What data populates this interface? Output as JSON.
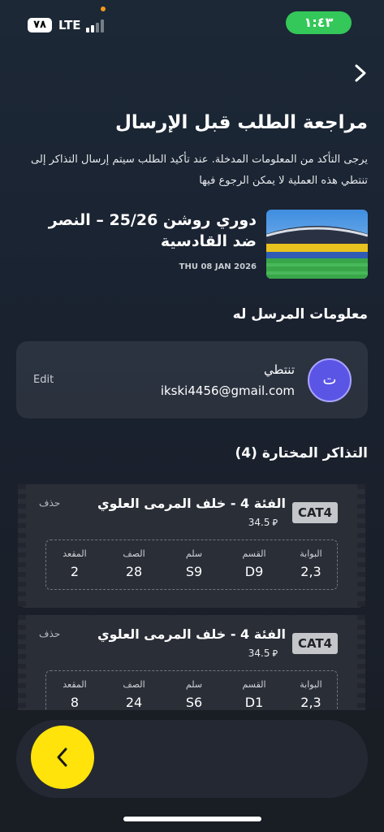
{
  "status_bar": {
    "battery": "٧٨",
    "network": "LTE",
    "time": "١:٤٣"
  },
  "header": {
    "title": "مراجعة الطلب قبل الإرسال",
    "description": "يرجى التأكد من المعلومات المدخلة. عند تأكيد الطلب سيتم إرسال التذاكر إلى تنتطي هذه العملية لا يمكن الرجوع فيها"
  },
  "match": {
    "title": "دوري روشن 25/26 – النصر ضد القادسية",
    "date": "THU 08 JAN 2026"
  },
  "sender": {
    "section_title": "معلومات المرسل له",
    "avatar_initial": "ت",
    "name": "تنتطي",
    "email": "ikski4456@gmail.com",
    "edit_label": "Edit"
  },
  "tickets_section": {
    "title": "التذاكر المختارة (4)"
  },
  "ticket_labels": {
    "gate": "البوابة",
    "section": "القسم",
    "stairs": "سلم",
    "row": "الصف",
    "seat": "المقعد",
    "delete": "حذف",
    "currency": "⃁"
  },
  "tickets": [
    {
      "title": "الفئة 4 - خلف المرمى العلوي",
      "price": "34.5",
      "badge": "CAT4",
      "gate": "2,3",
      "section": "D9",
      "stairs": "S9",
      "row": "28",
      "seat": "2"
    },
    {
      "title": "الفئة 4 - خلف المرمى العلوي",
      "price": "34.5",
      "badge": "CAT4",
      "gate": "2,3",
      "section": "D1",
      "stairs": "S6",
      "row": "24",
      "seat": "8"
    }
  ],
  "colors": {
    "accent": "#ffe30b",
    "avatar": "#5b55e6",
    "clock": "#34c759"
  },
  "icons": {
    "top_nav": "chevron-right-icon",
    "fab": "chevron-left-icon"
  }
}
